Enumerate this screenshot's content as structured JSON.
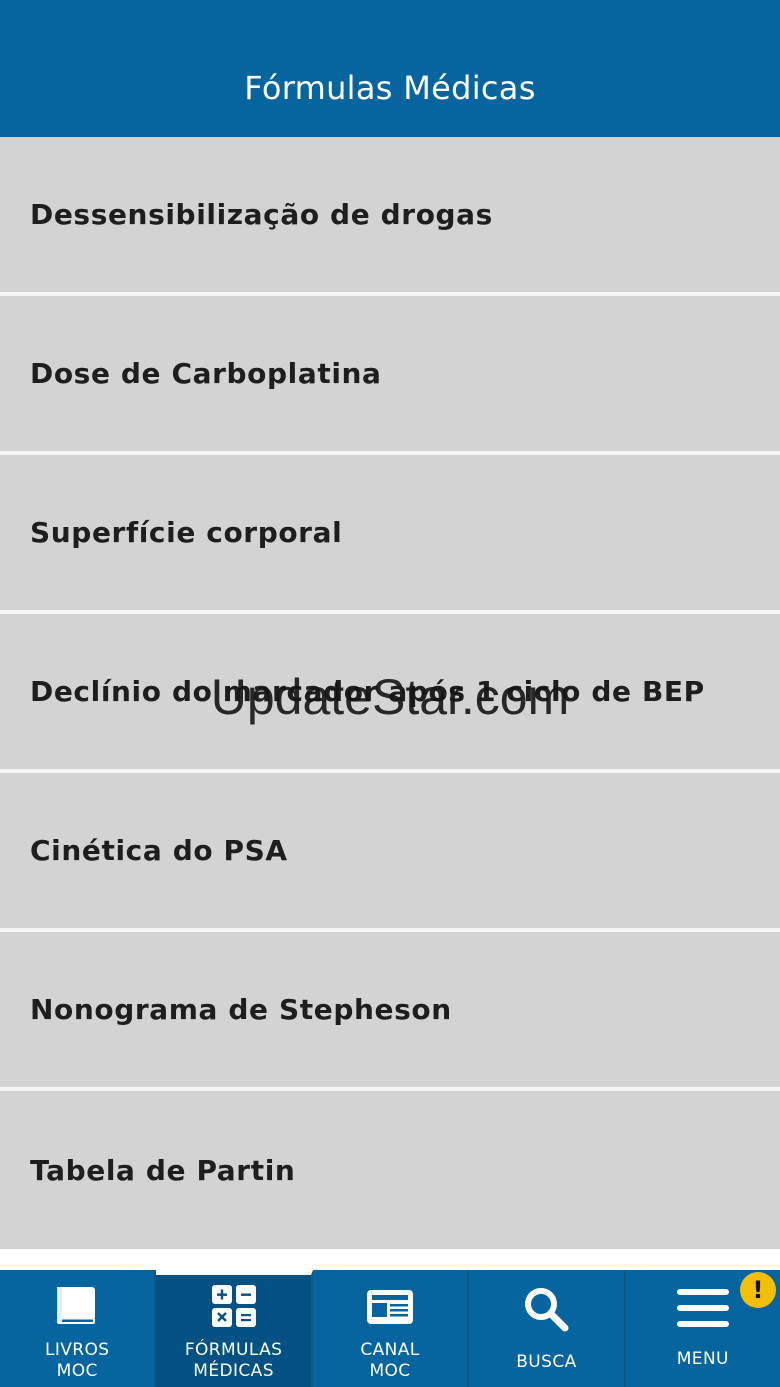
{
  "header": {
    "title": "Fórmulas Médicas"
  },
  "list": {
    "items": [
      {
        "label": "Dessensibilização de drogas"
      },
      {
        "label": "Dose de Carboplatina"
      },
      {
        "label": "Superfície corporal"
      },
      {
        "label": "Declínio do marcador após 1 ciclo de BEP"
      },
      {
        "label": "Cinética do PSA"
      },
      {
        "label": "Nonograma de Stepheson"
      },
      {
        "label": "Tabela de Partin"
      }
    ]
  },
  "watermark": "UpdateStar.com",
  "tabbar": {
    "tabs": [
      {
        "label_line1": "LIVROS",
        "label_line2": "MOC",
        "icon": "book-icon"
      },
      {
        "label_line1": "FÓRMULAS",
        "label_line2": "MÉDICAS",
        "icon": "calculator-icon",
        "active": true
      },
      {
        "label_line1": "CANAL",
        "label_line2": "MOC",
        "icon": "newspaper-icon"
      },
      {
        "label": "BUSCA",
        "icon": "search-icon"
      },
      {
        "label": "MENU",
        "icon": "hamburger-menu-icon",
        "badge": "!"
      }
    ]
  },
  "colors": {
    "primary": "#06649e",
    "active_tab": "#045183",
    "list_bg": "#d3d3d3",
    "badge": "#f2c000"
  }
}
